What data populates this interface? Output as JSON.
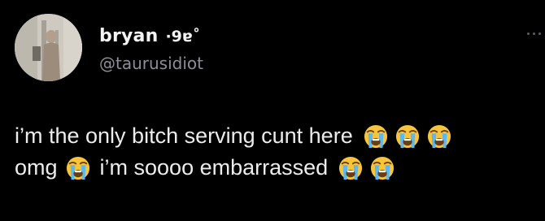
{
  "tweet": {
    "author": {
      "display_name": "bryan",
      "name_decoration": "·9ɐ˚",
      "handle": "@taurusidiot"
    },
    "text_line_1": "i’m the only bitch serving cunt here",
    "text_line_2a": "omg",
    "text_line_2b": "i’m soooo embarrassed",
    "emoji": "loudly-crying-face"
  },
  "colors": {
    "background": "#000000",
    "primary_text": "#e7e9ea",
    "secondary_text": "#8b9095"
  }
}
